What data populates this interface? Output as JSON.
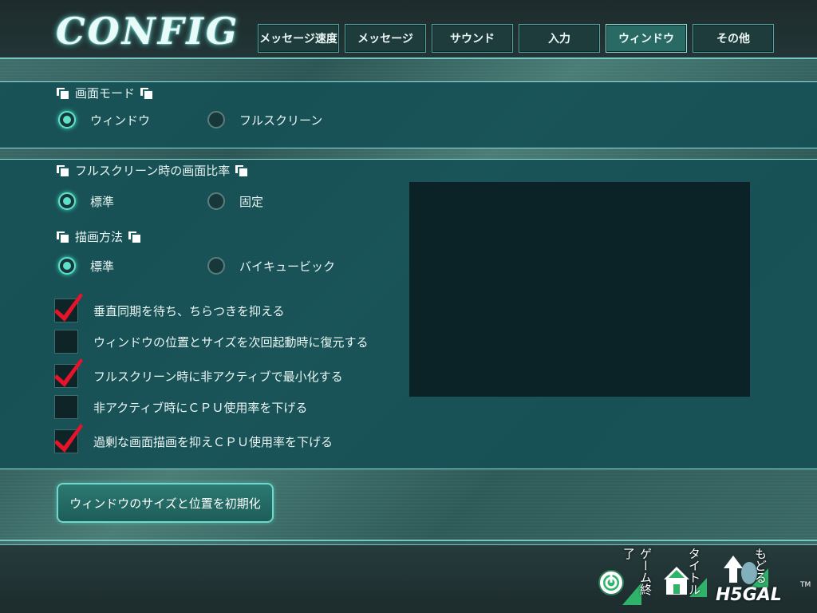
{
  "logo": {
    "text": "CONFIG"
  },
  "tabs": [
    {
      "label": "メッセージ速度",
      "active": false
    },
    {
      "label": "メッセージ",
      "active": false
    },
    {
      "label": "サウンド",
      "active": false
    },
    {
      "label": "入力",
      "active": false
    },
    {
      "label": "ウィンドウ",
      "active": true
    },
    {
      "label": "その他",
      "active": false
    }
  ],
  "screen_mode": {
    "heading": "画面モード",
    "options": [
      {
        "label": "ウィンドウ",
        "selected": true
      },
      {
        "label": "フルスクリーン",
        "selected": false
      }
    ]
  },
  "aspect_ratio": {
    "heading": "フルスクリーン時の画面比率",
    "options": [
      {
        "label": "標準",
        "selected": true
      },
      {
        "label": "固定",
        "selected": false
      }
    ]
  },
  "render_method": {
    "heading": "描画方法",
    "options": [
      {
        "label": "標準",
        "selected": true
      },
      {
        "label": "バイキュービック",
        "selected": false
      }
    ]
  },
  "checkboxes": [
    {
      "label": "垂直同期を待ち、ちらつきを抑える",
      "checked": true
    },
    {
      "label": "ウィンドウの位置とサイズを次回起動時に復元する",
      "checked": false
    },
    {
      "label": "フルスクリーン時に非アクティブで最小化する",
      "checked": true
    },
    {
      "label": "非アクティブ時にＣＰＵ使用率を下げる",
      "checked": false
    },
    {
      "label": "過剰な画面描画を抑えＣＰＵ使用率を下げる",
      "checked": true
    }
  ],
  "reset_button": {
    "label": "ウィンドウのサイズと位置を初期化"
  },
  "bottom_nav": {
    "quit": "ゲーム終了",
    "title": "タイトル",
    "back": "もどる"
  },
  "brand": {
    "text": "H5GAL",
    "tm": "TM"
  },
  "colors": {
    "accent": "#5fe0c8",
    "panel": "#165056",
    "check_mark": "#e8132a"
  }
}
